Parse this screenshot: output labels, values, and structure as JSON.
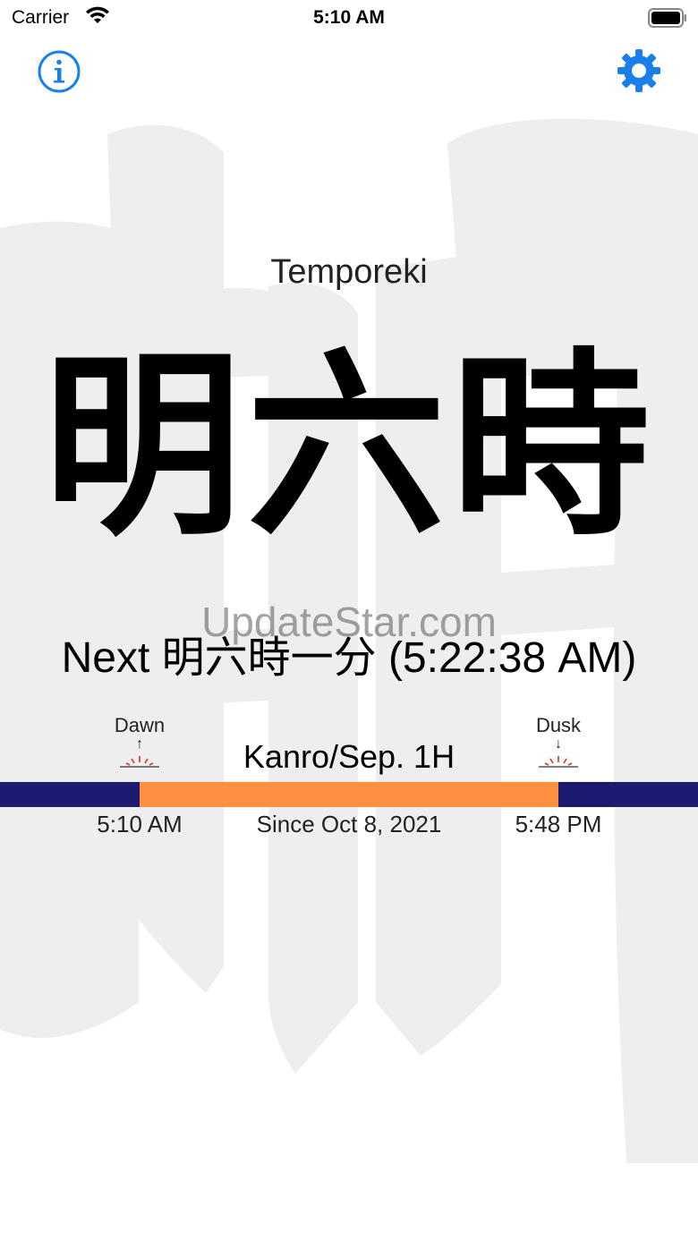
{
  "status_bar": {
    "carrier": "Carrier",
    "time": "5:10 AM"
  },
  "header": {
    "info_icon": "info-icon",
    "settings_icon": "gear-icon"
  },
  "app_title": "Temporeki",
  "current_hour": "明六時",
  "watermark": "UpdateStar.com",
  "next": "Next 明六時一分 (5:22:38 AM)",
  "timeline": {
    "dawn_label": "Dawn",
    "dawn_arrow": "↑",
    "dusk_label": "Dusk",
    "dusk_arrow": "↓",
    "sekki": "Kanro/Sep. 1H",
    "dawn_time": "5:10 AM",
    "since": "Since Oct 8, 2021",
    "dusk_time": "5:48 PM",
    "daylight_start_fraction": 0.2,
    "daylight_end_fraction": 0.8
  },
  "colors": {
    "accent": "#1a7fe8",
    "night": "#1b1b6f",
    "day": "#ff9040",
    "sun_marker": "#e0301e",
    "background_glyph": "#eeeeee"
  }
}
